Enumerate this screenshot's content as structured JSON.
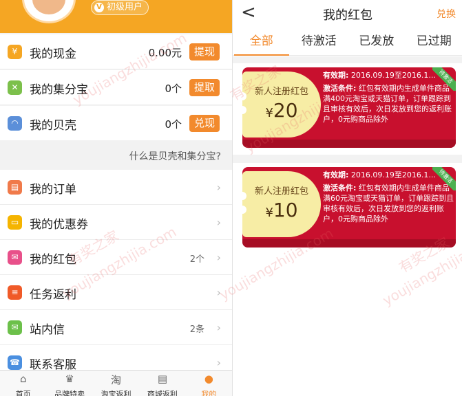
{
  "left": {
    "user_level": "初级用户",
    "accounts": [
      {
        "label": "我的现金",
        "value": "0.00元",
        "button": "提现",
        "icon": "cash-icon",
        "color": "#f5a623"
      },
      {
        "label": "我的集分宝",
        "value": "0个",
        "button": "提取",
        "icon": "jifenbao-icon",
        "color": "#7cc04b"
      },
      {
        "label": "我的贝壳",
        "value": "0个",
        "button": "兑现",
        "icon": "shell-icon",
        "color": "#5b8fd9"
      }
    ],
    "info_link": "什么是贝壳和集分宝?",
    "menu": [
      {
        "label": "我的订单",
        "count": "",
        "icon": "order-icon",
        "color": "#f07a4a"
      },
      {
        "label": "我的优惠券",
        "count": "",
        "icon": "coupon-icon",
        "color": "#f5b400"
      },
      {
        "label": "我的红包",
        "count": "2个",
        "icon": "red-packet-icon",
        "color": "#e8508a"
      },
      {
        "label": "任务返利",
        "count": "",
        "icon": "task-icon",
        "color": "#f05a28"
      },
      {
        "label": "站内信",
        "count": "2条",
        "icon": "mail-icon",
        "color": "#6cc04a"
      },
      {
        "label": "联系客服",
        "count": "",
        "icon": "service-icon",
        "color": "#4a8fe0"
      }
    ],
    "tabs": [
      {
        "label": "首页",
        "icon": "home-icon",
        "glyph": "⌂"
      },
      {
        "label": "品牌特卖",
        "icon": "crown-icon",
        "glyph": "♛"
      },
      {
        "label": "淘宝返利",
        "icon": "taobao-icon",
        "glyph": "淘"
      },
      {
        "label": "商城返利",
        "icon": "store-icon",
        "glyph": "▤"
      },
      {
        "label": "我的",
        "icon": "user-icon",
        "glyph": "●"
      }
    ]
  },
  "right": {
    "title": "我的红包",
    "back": "<",
    "redeem": "兑换",
    "tabs": [
      "全部",
      "待激活",
      "已发放",
      "已过期"
    ],
    "envelopes": [
      {
        "name": "新人注册红包",
        "currency": "¥",
        "amount": "20",
        "validity_label": "有效期:",
        "validity": "2016.09.19至2016.1...",
        "cond_label": "激活条件:",
        "condition": "红包有效期内生成单件商品满400元淘宝或天猫订单，订单跟踪到且审核有效后，次日发放到您的返利账户，0元购商品除外",
        "status": "待激活"
      },
      {
        "name": "新人注册红包",
        "currency": "¥",
        "amount": "10",
        "validity_label": "有效期:",
        "validity": "2016.09.19至2016.1...",
        "cond_label": "激活条件:",
        "condition": "红包有效期内生成单件商品满60元淘宝或天猫订单，订单跟踪到且审核有效后，次日发放到您的返利账户，0元购商品除外",
        "status": "待激活"
      }
    ]
  },
  "watermark": {
    "cn": "有奖之家",
    "en": "youjiangzhijia.com"
  }
}
